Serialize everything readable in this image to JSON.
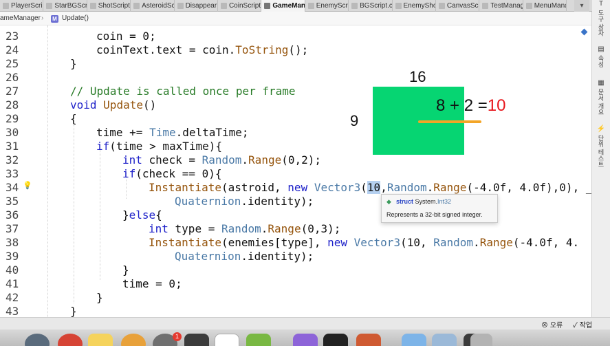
{
  "tabs": [
    {
      "label": "PlayerScri",
      "active": false
    },
    {
      "label": "StarBGScr",
      "active": false
    },
    {
      "label": "ShotScript",
      "active": false
    },
    {
      "label": "AsteroidSc",
      "active": false
    },
    {
      "label": "Disappear",
      "active": false
    },
    {
      "label": "CoinScript",
      "active": false
    },
    {
      "label": "GameManag",
      "active": true
    },
    {
      "label": "EnemyScri",
      "active": false
    },
    {
      "label": "BGScript.c",
      "active": false
    },
    {
      "label": "EnemySho",
      "active": false
    },
    {
      "label": "CanvasScr",
      "active": false
    },
    {
      "label": "TestManag",
      "active": false
    },
    {
      "label": "MenuMana",
      "active": false
    }
  ],
  "tab_close_glyph": "×",
  "tab_menu_glyph": "▾",
  "breadcrumb": {
    "file": "ameManager",
    "separator": "›",
    "member_badge": "M",
    "member": "Update()"
  },
  "line_numbers": [
    "23",
    "24",
    "25",
    "26",
    "27",
    "28",
    "29",
    "30",
    "31",
    "32",
    "33",
    "34",
    "35",
    "36",
    "37",
    "38",
    "39",
    "40",
    "41",
    "42",
    "43"
  ],
  "code": {
    "l23": {
      "a": "coin = 0;"
    },
    "l24": {
      "a": "coinText.text = coin.",
      "b": "ToString",
      "c": "();"
    },
    "l25": {
      "a": "}"
    },
    "l27": {
      "a": "// Update is called once per frame"
    },
    "l28": {
      "kw": "void",
      "me": "Update",
      "c": "()"
    },
    "l29": {
      "a": "{"
    },
    "l30": {
      "a": "time += ",
      "ty": "Time",
      "b": ".deltaTime;"
    },
    "l31": {
      "kw": "if",
      "a": "(time > maxTime){"
    },
    "l32": {
      "kw": "int",
      "a": " check = ",
      "ty": "Random",
      "b": ".",
      "me": "Range",
      "c": "(0,2);"
    },
    "l33": {
      "kw": "if",
      "a": "(check == 0){"
    },
    "l34": {
      "me": "Instantiate",
      "a": "(astroid, ",
      "kw": "new",
      "ty": "Vector3",
      "b": "(",
      "sel": "10",
      "c": ",",
      "ty2": "Random",
      "d": ".",
      "me2": "Range",
      "e": "(-4.0f, 4.0f),0), _"
    },
    "l35": {
      "ty": "Quaternion",
      "a": ".identity);"
    },
    "l36": {
      "a": "}",
      "kw": "else",
      "b": "{"
    },
    "l37": {
      "kw": "int",
      "a": " type = ",
      "ty": "Random",
      "b": ".",
      "me": "Range",
      "c": "(0,3);"
    },
    "l38": {
      "me": "Instantiate",
      "a": "(enemies[type], ",
      "kw": "new",
      "ty": "Vector3",
      "b": "(10, ",
      "ty2": "Random",
      "c": ".",
      "me2": "Range",
      "d": "(-4.0f, 4."
    },
    "l39": {
      "ty": "Quaternion",
      "a": ".identity);"
    },
    "l40": {
      "a": "}"
    },
    "l41": {
      "a": "time = 0;"
    },
    "l42": {
      "a": "}"
    },
    "l43": {
      "a": "}"
    }
  },
  "overlay": {
    "top_number": "16",
    "left_number": "9",
    "equation": "8 + 2 =",
    "result": "10"
  },
  "tooltip": {
    "icon": "◆",
    "keyword": "struct",
    "namespace": "System.",
    "type": "Int32",
    "doc": "Represents a 32-bit signed integer."
  },
  "right_panel": [
    {
      "icon": "T",
      "label": "도구 상자"
    },
    {
      "icon": "▤",
      "label": "속성"
    },
    {
      "icon": "▦",
      "label": "문서 개요"
    },
    {
      "icon": "⚡",
      "label": "단위 테스트"
    }
  ],
  "status": {
    "error_icon": "⊗",
    "error_label": "오류",
    "task_icon": "✓",
    "task_label": "작업"
  },
  "dock_badge": "1",
  "colors": {
    "keyword": "#1e21c9",
    "type": "#4a79a6",
    "method": "#95540c",
    "comment": "#267a25",
    "green_box": "#06d572",
    "result_red": "#e8161c",
    "underline_orange": "#f3a527"
  }
}
